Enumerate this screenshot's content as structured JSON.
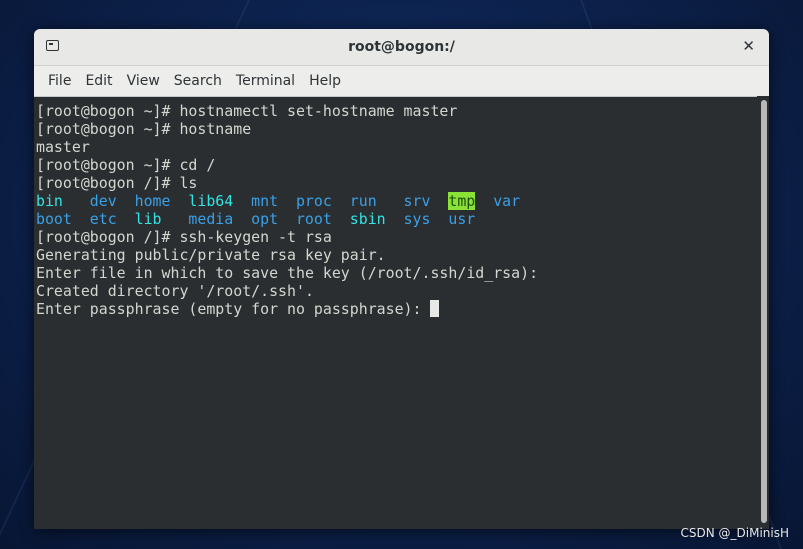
{
  "window": {
    "title": "root@bogon:/",
    "close_label": "✕"
  },
  "menu": [
    "File",
    "Edit",
    "View",
    "Search",
    "Terminal",
    "Help"
  ],
  "terminal": {
    "lines_before": [
      "[root@bogon ~]# hostnamectl set-hostname master",
      "[root@bogon ~]# hostname",
      "master",
      "[root@bogon ~]# cd /",
      "[root@bogon /]# ls"
    ],
    "ls_rows": [
      [
        {
          "text": "bin",
          "color": "cyan"
        },
        {
          "text": "dev",
          "color": "blue"
        },
        {
          "text": "home",
          "color": "blue"
        },
        {
          "text": "lib64",
          "color": "cyan"
        },
        {
          "text": "mnt",
          "color": "blue"
        },
        {
          "text": "proc",
          "color": "blue"
        },
        {
          "text": "run",
          "color": "blue"
        },
        {
          "text": "srv",
          "color": "blue"
        },
        {
          "text": "tmp",
          "color": "tmp"
        },
        {
          "text": "var",
          "color": "blue"
        }
      ],
      [
        {
          "text": "boot",
          "color": "blue"
        },
        {
          "text": "etc",
          "color": "blue"
        },
        {
          "text": "lib",
          "color": "cyan"
        },
        {
          "text": "media",
          "color": "blue"
        },
        {
          "text": "opt",
          "color": "blue"
        },
        {
          "text": "root",
          "color": "blue"
        },
        {
          "text": "sbin",
          "color": "cyan"
        },
        {
          "text": "sys",
          "color": "blue"
        },
        {
          "text": "usr",
          "color": "blue"
        }
      ]
    ],
    "lines_after": [
      "[root@bogon /]# ssh-keygen -t rsa",
      "Generating public/private rsa key pair.",
      "Enter file in which to save the key (/root/.ssh/id_rsa):",
      "Created directory '/root/.ssh'.",
      "Enter passphrase (empty for no passphrase): "
    ]
  },
  "colors": {
    "blue": "#3aa0e8",
    "cyan": "#34e2e2",
    "tmp_bg": "#8ae234",
    "tmp_fg": "#1f4d13"
  },
  "watermark": "CSDN @_DiMinisH"
}
